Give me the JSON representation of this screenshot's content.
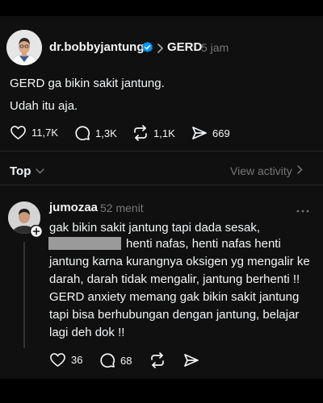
{
  "post": {
    "author": "dr.bobbyjantung",
    "community": "GERD",
    "time": "5 jam",
    "text_line1": "GERD ga bikin sakit jantung.",
    "text_line2": "Udah itu aja.",
    "likes": "11,7K",
    "comments": "1,3K",
    "reposts": "1,1K",
    "shares": "669"
  },
  "sort": {
    "label": "Top",
    "view_activity": "View activity"
  },
  "reply": {
    "author": "jumozaa",
    "time": "52 menit",
    "line1": "gak bikin sakit jantung tapi dada sesak,",
    "line2": "henti nafas, henti nafas henti",
    "line3": "jantung karna kurangnya oksigen yg mengalir ke",
    "line4": "darah, darah tidak mengalir, jantung berhenti !!",
    "line5": "GERD anxiety memang gak bikin sakit jantung",
    "line6": "tapi bisa berhubungan dengan jantung, belajar",
    "line7": "lagi deh dok !!",
    "likes": "36",
    "comments": "68"
  },
  "icons": {
    "verified": "verified-badge-icon",
    "chevron": "chevron-right-icon",
    "like": "heart-icon",
    "comment": "speech-bubble-icon",
    "repost": "repost-icon",
    "share": "send-icon",
    "more": "ellipsis-icon",
    "follow": "plus-icon"
  },
  "colors": {
    "background": "#101010",
    "verified": "#0095f6",
    "muted": "#777777"
  }
}
